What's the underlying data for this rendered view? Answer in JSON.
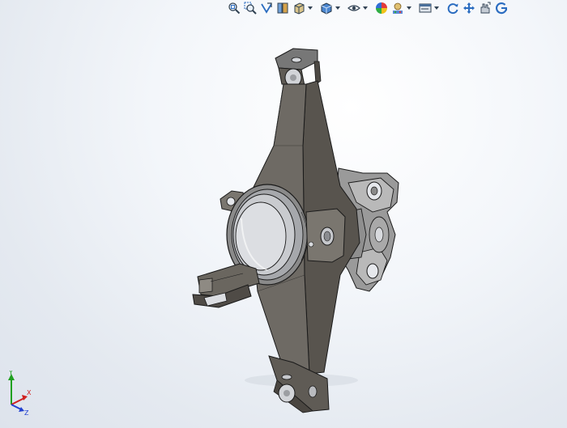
{
  "toolbar": {
    "items": [
      {
        "name": "zoom-to-fit-icon",
        "dropdown": false
      },
      {
        "name": "zoom-to-area-icon",
        "dropdown": false
      },
      {
        "name": "previous-view-icon",
        "dropdown": false
      },
      {
        "name": "section-view-icon",
        "dropdown": false
      },
      {
        "name": "view-orientation-icon",
        "dropdown": true
      },
      {
        "name": "display-style-icon",
        "dropdown": true
      },
      {
        "name": "hide-show-items-icon",
        "dropdown": true
      },
      {
        "name": "edit-appearance-icon",
        "dropdown": false
      },
      {
        "name": "apply-scene-icon",
        "dropdown": true
      },
      {
        "name": "view-settings-icon",
        "dropdown": true
      },
      {
        "name": "rotate-view-icon",
        "dropdown": false
      },
      {
        "name": "pan-icon",
        "dropdown": false
      },
      {
        "name": "zoom-in-out-icon",
        "dropdown": false
      },
      {
        "name": "roll-view-icon",
        "dropdown": false
      }
    ]
  },
  "triad": {
    "x_label": "X",
    "y_label": "Y",
    "z_label": "Z",
    "colors": {
      "x": "#d02020",
      "y": "#20a020",
      "z": "#2040d0"
    }
  },
  "model": {
    "body_color": "#6e6a64",
    "hub_color": "#8a8a8a",
    "bore_color": "#c9cbcf",
    "edge_color": "#1a1a1a"
  }
}
